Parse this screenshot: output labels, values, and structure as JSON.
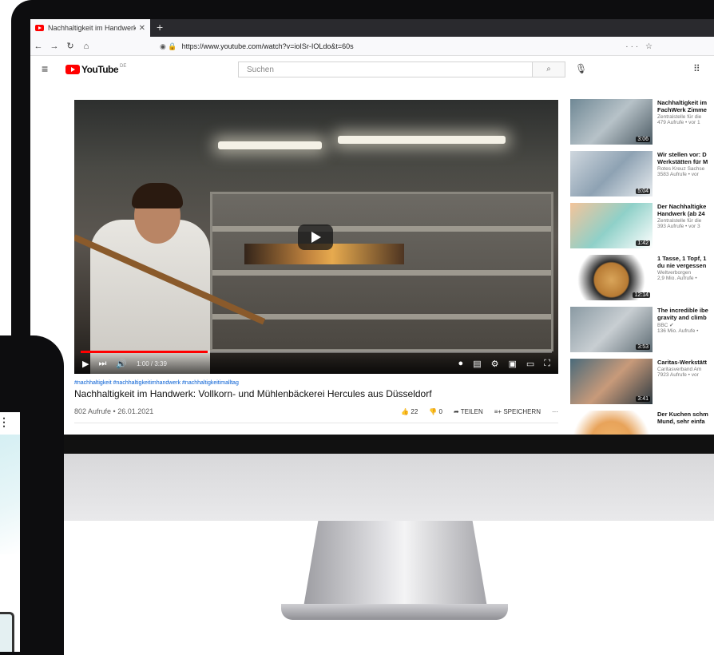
{
  "browser": {
    "tab_title": "Nachhaltigkeit im Handwerk: V",
    "tab_close": "✕",
    "new_tab": "+",
    "url": "https://www.youtube.com/watch?v=ioISr-IOLdo&t=60s",
    "url_actions": "··· ☆"
  },
  "yt": {
    "logo_text": "YouTube",
    "country": "DE",
    "search_placeholder": "Suchen"
  },
  "video": {
    "hashtags": "#nachhaltigkeit #nachhaltigkeitimhandwerk #nachhaltigkeitimalltag",
    "title": "Nachhaltigkeit im Handwerk: Vollkorn- und Mühlenbäckerei Hercules aus Düsseldorf",
    "views_date": "802 Aufrufe • 26.01.2021",
    "time": "1:00 / 3:39",
    "progress": 0.27,
    "likes": "22",
    "dislikes": "0",
    "share_label": "TEILEN",
    "save_label": "SPEICHERN"
  },
  "sidebar": [
    {
      "title1": "Nachhaltigkeit im",
      "title2": "FachWerk Zimme",
      "channel": "Zentralstelle für die",
      "stats": "479 Aufrufe • vor 1",
      "duration": "3:06"
    },
    {
      "title1": "Wir stellen vor: D",
      "title2": "Werkstätten für M",
      "channel": "Rotes Kreuz Sachse",
      "stats": "3583 Aufrufe • vor",
      "duration": "5:04"
    },
    {
      "title1": "Der Nachhaltigke",
      "title2": "Handwerk (ab 24",
      "channel": "Zentralstelle für die",
      "stats": "393 Aufrufe • vor 3",
      "duration": "1:42"
    },
    {
      "title1": "1 Tasse, 1 Topf, 1",
      "title2": "du nie vergessen",
      "channel": "Weltverborgen",
      "stats": "2,9 Mio. Aufrufe •",
      "duration": "12:14"
    },
    {
      "title1": "The incredible ibe",
      "title2": "gravity and climb",
      "channel": "BBC ✔",
      "stats": "136 Mio. Aufrufe •",
      "duration": "3:53"
    },
    {
      "title1": "Caritas-Werkstätt",
      "title2": "",
      "channel": "Caritasverband Am",
      "stats": "7923 Aufrufe • vor",
      "duration": "3:41"
    },
    {
      "title1": "Der Kuchen schm",
      "title2": "Mund, sehr einfa",
      "channel": "",
      "stats": "",
      "duration": ""
    }
  ]
}
